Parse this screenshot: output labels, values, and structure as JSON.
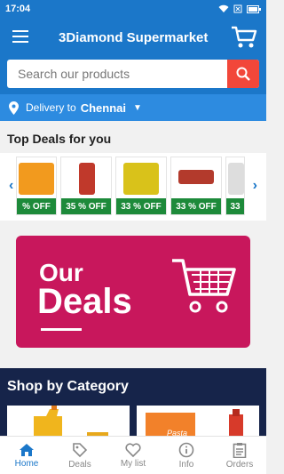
{
  "status": {
    "time": "17:04"
  },
  "app": {
    "title": "3Diamond Supermarket"
  },
  "search": {
    "placeholder": "Search our products"
  },
  "delivery": {
    "label": "Delivery to",
    "city": "Chennai"
  },
  "deals": {
    "heading": "Top Deals for you",
    "items": [
      {
        "offer": "% OFF",
        "color": "#f29a1e"
      },
      {
        "offer": "35 % OFF",
        "color": "#c0392b"
      },
      {
        "offer": "33 % OFF",
        "color": "#d9c21a"
      },
      {
        "offer": "33 % OFF",
        "color": "#b33a2c"
      },
      {
        "offer": "33",
        "color": "#dddddd"
      }
    ]
  },
  "banner": {
    "line1": "Our",
    "line2": "Deals"
  },
  "category": {
    "heading": "Shop by Category",
    "card2_text": "Pasta"
  },
  "nav": [
    {
      "label": "Home",
      "icon": "home-icon",
      "active": true
    },
    {
      "label": "Deals",
      "icon": "tag-icon",
      "active": false
    },
    {
      "label": "My list",
      "icon": "heart-icon",
      "active": false
    },
    {
      "label": "Info",
      "icon": "info-icon",
      "active": false
    },
    {
      "label": "Orders",
      "icon": "orders-icon",
      "active": false
    }
  ],
  "colors": {
    "primary": "#1b77c9",
    "banner": "#c8175c",
    "offer": "#1d8a3a",
    "category_bg": "#16244a",
    "search_button": "#f2473a"
  }
}
